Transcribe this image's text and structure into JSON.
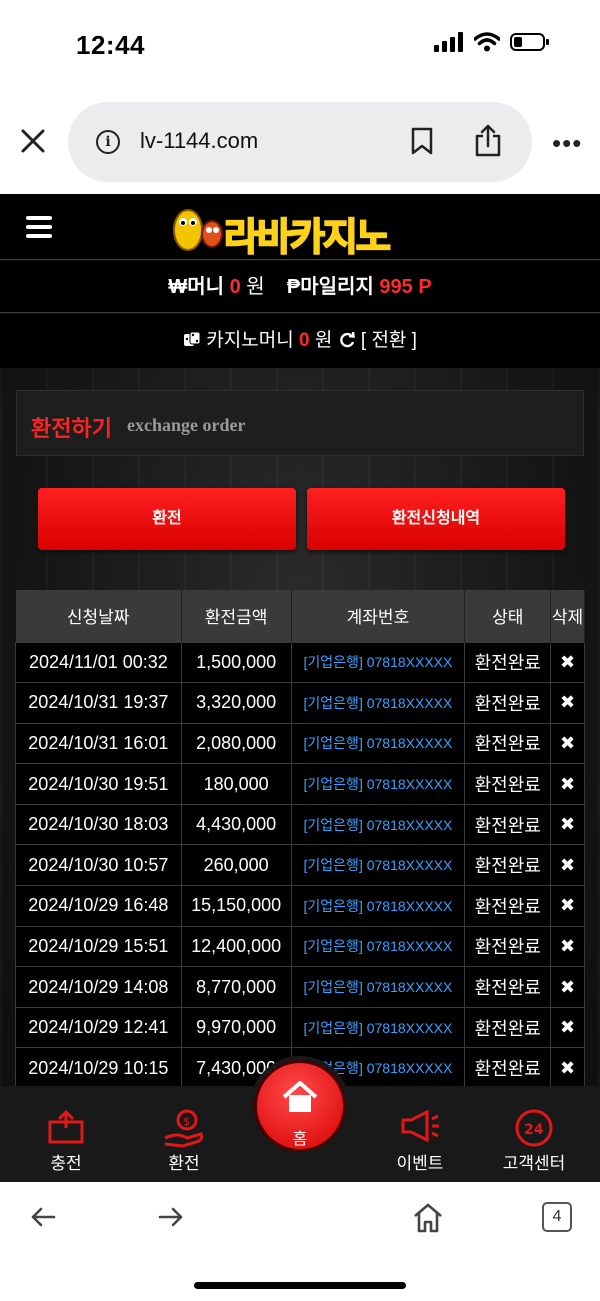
{
  "status": {
    "time": "12:44"
  },
  "browser": {
    "url": "lv-1144.com",
    "tab_count": "4"
  },
  "site": {
    "logo_text": "라바카지노",
    "money_prefix": "₩머니",
    "money_value": "0",
    "money_unit": "원",
    "mileage_prefix": "₱마일리지",
    "mileage_value": "995 P",
    "casino_prefix": "카지노머니",
    "casino_value": "0",
    "casino_unit": "원",
    "convert_label": "[ 전환 ]"
  },
  "panel": {
    "title": "환전하기",
    "subtitle": "exchange order"
  },
  "buttons": {
    "exchange": "환전",
    "history": "환전신청내역"
  },
  "table": {
    "headers": [
      "신청날짜",
      "환전금액",
      "계좌번호",
      "상태",
      "삭제"
    ],
    "rows": [
      [
        "2024/11/01 00:32",
        "1,500,000",
        "[기업은행] 07818XXXXX",
        "환전완료",
        "✖"
      ],
      [
        "2024/10/31 19:37",
        "3,320,000",
        "[기업은행] 07818XXXXX",
        "환전완료",
        "✖"
      ],
      [
        "2024/10/31 16:01",
        "2,080,000",
        "[기업은행] 07818XXXXX",
        "환전완료",
        "✖"
      ],
      [
        "2024/10/30 19:51",
        "180,000",
        "[기업은행] 07818XXXXX",
        "환전완료",
        "✖"
      ],
      [
        "2024/10/30 18:03",
        "4,430,000",
        "[기업은행] 07818XXXXX",
        "환전완료",
        "✖"
      ],
      [
        "2024/10/30 10:57",
        "260,000",
        "[기업은행] 07818XXXXX",
        "환전완료",
        "✖"
      ],
      [
        "2024/10/29 16:48",
        "15,150,000",
        "[기업은행] 07818XXXXX",
        "환전완료",
        "✖"
      ],
      [
        "2024/10/29 15:51",
        "12,400,000",
        "[기업은행] 07818XXXXX",
        "환전완료",
        "✖"
      ],
      [
        "2024/10/29 14:08",
        "8,770,000",
        "[기업은행] 07818XXXXX",
        "환전완료",
        "✖"
      ],
      [
        "2024/10/29 12:41",
        "9,970,000",
        "[기업은행] 07818XXXXX",
        "환전완료",
        "✖"
      ],
      [
        "2024/10/29 10:15",
        "7,430,000",
        "[기업은행] 07818XXXXX",
        "환전완료",
        "✖"
      ]
    ]
  },
  "bottom_nav": {
    "deposit": "충전",
    "exchange": "환전",
    "home": "홈",
    "event": "이벤트",
    "support": "고객센터"
  },
  "icons": [
    "signal-icon",
    "wifi-icon",
    "battery-icon",
    "close-icon",
    "info-icon",
    "bookmark-icon",
    "share-icon",
    "more-icon",
    "menu-icon",
    "dice-icon",
    "refresh-icon",
    "back-icon",
    "forward-icon",
    "home-icon",
    "tabs-icon"
  ],
  "colors": {
    "accent_red": "#ff2a2a",
    "link_blue": "#3aa0ff",
    "site_bg": "#131313"
  }
}
